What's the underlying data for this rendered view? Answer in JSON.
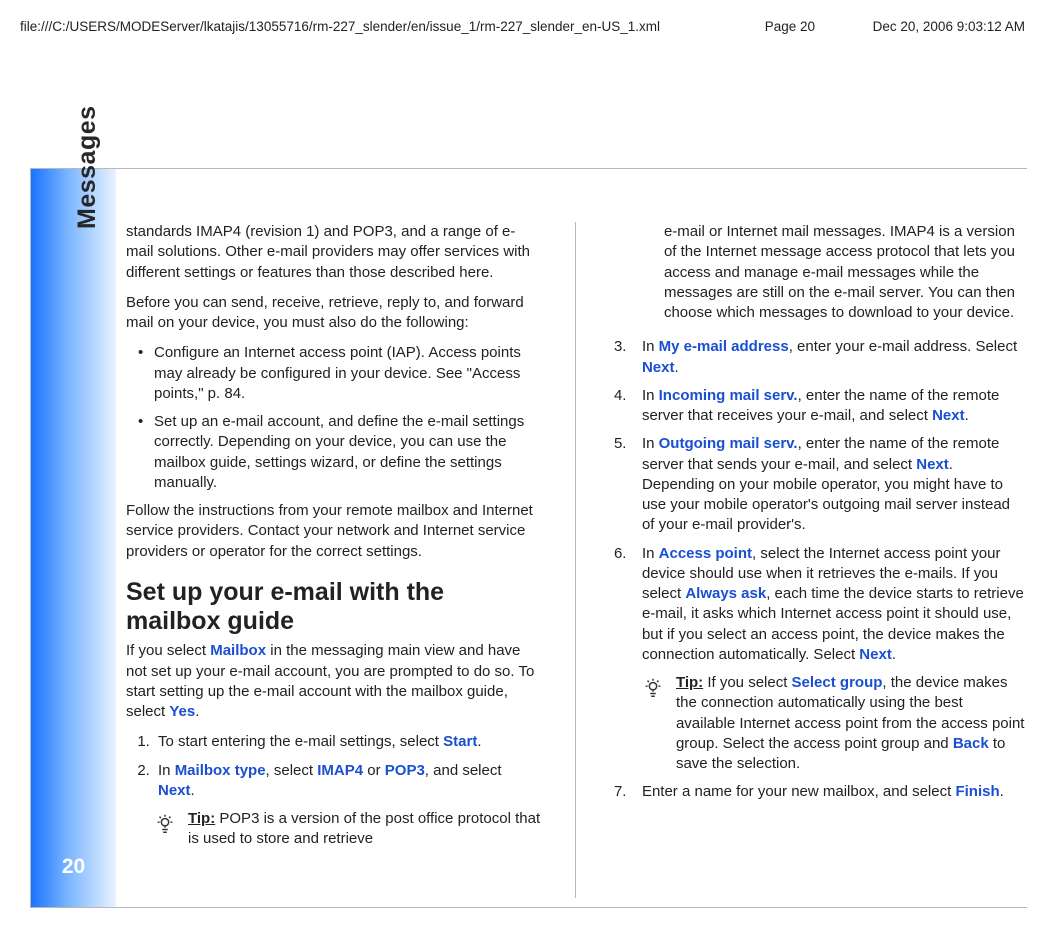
{
  "header": {
    "path": "file:///C:/USERS/MODEServer/lkatajis/13055716/rm-227_slender/en/issue_1/rm-227_slender_en-US_1.xml",
    "page": "Page 20",
    "timestamp": "Dec 20, 2006 9:03:12 AM"
  },
  "sidebar": {
    "label": "Messages",
    "pageNumber": "20"
  },
  "left": {
    "para1": "standards IMAP4 (revision 1) and POP3, and a range of e-mail solutions. Other e-mail providers may offer services with different settings or features than those described here.",
    "para2": "Before you can send, receive, retrieve, reply to, and forward mail on your device, you must also do the following:",
    "bullet1": "Configure an Internet access point (IAP). Access points may already be configured in your device. See \"Access points,\" p. 84.",
    "bullet2": "Set up an e-mail account, and define the e-mail settings correctly. Depending on your device, you can use the mailbox guide, settings wizard, or define the settings manually.",
    "para3": "Follow the instructions from your remote mailbox and Internet service providers. Contact your network and Internet service providers or operator for the correct settings.",
    "h2": "Set up your e-mail with the mailbox guide",
    "para4_a": "If you select ",
    "para4_term1": "Mailbox",
    "para4_b": " in the messaging main view and have not set up your e-mail account, you are prompted to do so. To start setting up the e-mail account with the mailbox guide, select ",
    "para4_term2": "Yes",
    "para4_c": ".",
    "step1_a": "To start entering the e-mail settings, select ",
    "step1_term": "Start",
    "step1_b": ".",
    "step2_a": "In ",
    "step2_term1": "Mailbox type",
    "step2_b": ", select ",
    "step2_term2": "IMAP4",
    "step2_c": " or ",
    "step2_term3": "POP3",
    "step2_d": ", and select ",
    "step2_term4": "Next",
    "step2_e": ".",
    "tip_label": "Tip:",
    "tip1": " POP3 is a version of the post office protocol that is used to store and retrieve"
  },
  "right": {
    "tip1_cont": "e-mail or Internet mail messages. IMAP4 is a version of the Internet message access protocol that lets you access and manage e-mail messages while the messages are still on the e-mail server. You can then choose which messages to download to your device.",
    "step3_a": "In ",
    "step3_term1": "My e-mail address",
    "step3_b": ", enter your e-mail address. Select ",
    "step3_term2": "Next",
    "step3_c": ".",
    "step4_a": "In ",
    "step4_term1": "Incoming mail serv.",
    "step4_b": ", enter the name of the remote server that receives your e-mail, and select ",
    "step4_term2": "Next",
    "step4_c": ".",
    "step5_a": "In ",
    "step5_term1": "Outgoing mail serv.",
    "step5_b": ", enter the name of the remote server that sends your e-mail, and select ",
    "step5_term2": "Next",
    "step5_c": ". Depending on your mobile operator, you might have to use your mobile operator's outgoing mail server instead of your e-mail provider's.",
    "step6_a": "In ",
    "step6_term1": "Access point",
    "step6_b": ", select the Internet access point your device should use when it retrieves the e-mails. If you select ",
    "step6_term2": "Always ask",
    "step6_c": ", each time the device starts to retrieve e-mail, it asks which Internet access point it should use, but if you select an access point, the device makes the connection automatically. Select ",
    "step6_term3": "Next",
    "step6_d": ".",
    "tip2_a": " If you select ",
    "tip2_term1": "Select group",
    "tip2_b": ", the device makes the connection automatically using the best available Internet access point from the access point group. Select the access point group and ",
    "tip2_term2": "Back",
    "tip2_c": " to save the selection.",
    "step7_a": "Enter a name for your new mailbox, and select ",
    "step7_term": "Finish",
    "step7_b": "."
  }
}
